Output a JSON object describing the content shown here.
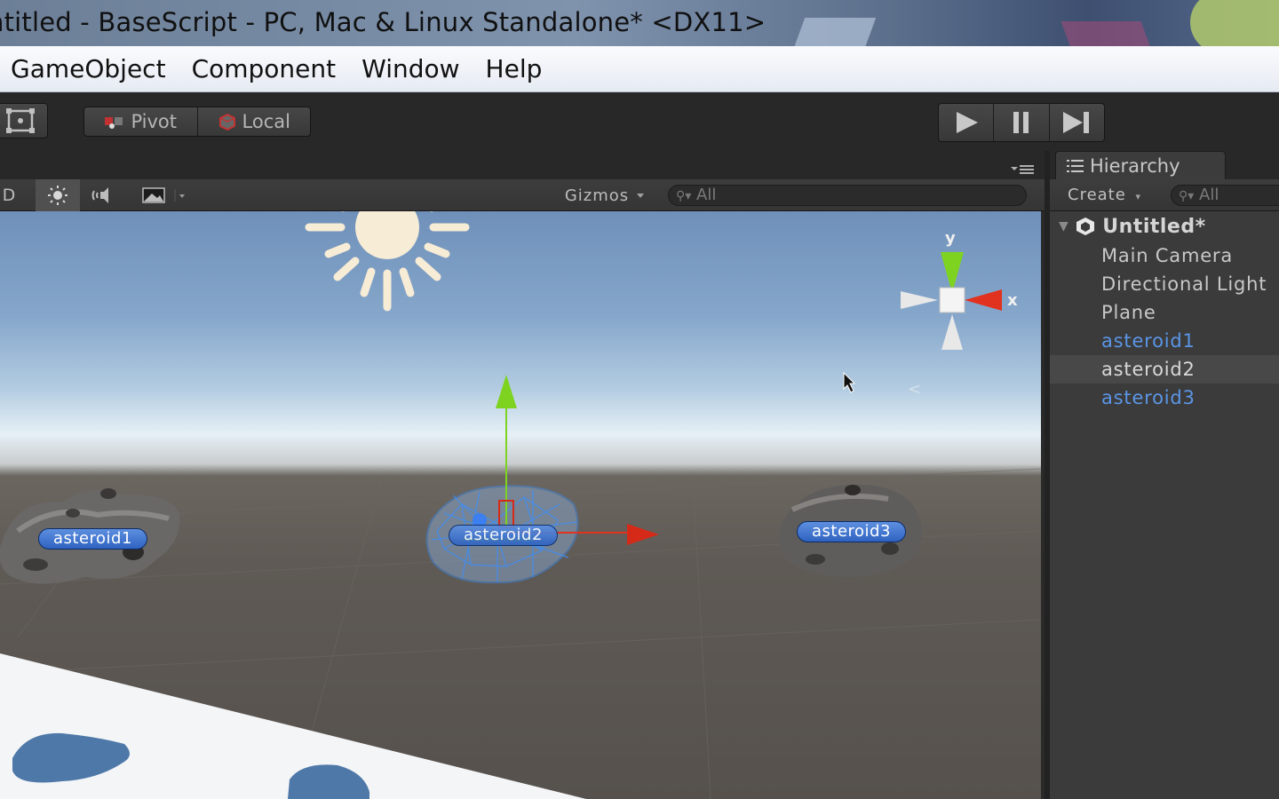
{
  "window": {
    "title": "ntitled - BaseScript - PC, Mac & Linux Standalone* <DX11>"
  },
  "menubar": {
    "items": [
      "GameObject",
      "Component",
      "Window",
      "Help"
    ]
  },
  "toolbar": {
    "pivot_label": "Pivot",
    "local_label": "Local"
  },
  "scene": {
    "mode_2d": "D",
    "gizmos_label": "Gizmos",
    "search_placeholder": "All",
    "axis_y": "y",
    "axis_x": "x",
    "labels": {
      "asteroid1": "asteroid1",
      "asteroid2": "asteroid2",
      "asteroid3": "asteroid3"
    }
  },
  "hierarchy": {
    "tab_label": "Hierarchy",
    "create_label": "Create",
    "search_placeholder": "All",
    "root": "Untitled*",
    "items": [
      "Main Camera",
      "Directional Light",
      "Plane",
      "asteroid1",
      "asteroid2",
      "asteroid3"
    ]
  },
  "colors": {
    "prefab_text": "#5b95e6",
    "label_bg": "#3b70cc",
    "axis_x": "#e0321e",
    "axis_y": "#7ed321"
  }
}
